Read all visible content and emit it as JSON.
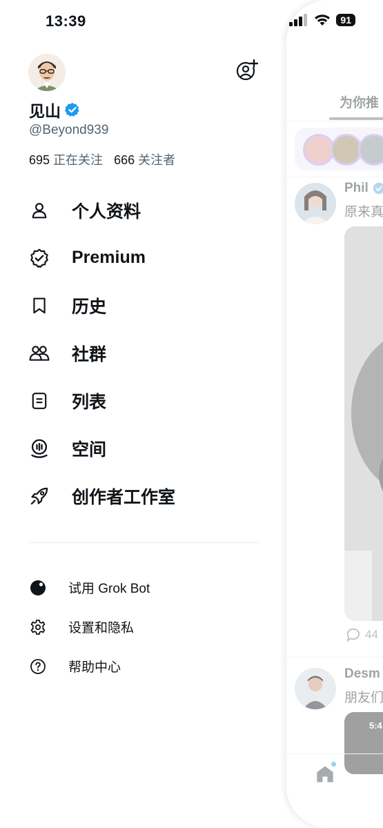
{
  "status_bar": {
    "time": "13:39",
    "battery": "91"
  },
  "profile": {
    "display_name": "见山",
    "handle": "@Beyond939",
    "following_count": "695",
    "following_label": "正在关注",
    "followers_count": "666",
    "followers_label": "关注者"
  },
  "menu": [
    {
      "label": "个人资料",
      "icon": "person-icon"
    },
    {
      "label": "Premium",
      "icon": "premium-badge-icon"
    },
    {
      "label": "历史",
      "icon": "bookmark-icon"
    },
    {
      "label": "社群",
      "icon": "communities-icon"
    },
    {
      "label": "列表",
      "icon": "list-icon"
    },
    {
      "label": "空间",
      "icon": "spaces-icon"
    },
    {
      "label": "创作者工作室",
      "icon": "rocket-icon"
    }
  ],
  "sub_menu": [
    {
      "label": "试用 Grok Bot",
      "icon": "grok-icon"
    },
    {
      "label": "设置和隐私",
      "icon": "gear-icon"
    },
    {
      "label": "帮助中心",
      "icon": "help-icon"
    }
  ],
  "feed": {
    "tab_label": "为你推",
    "post1_name": "Phil",
    "post1_text": "原来真",
    "post1_replies": "44",
    "post2_name": "Desm",
    "post2_text": "朋友们",
    "post2_media_time": "5:4"
  },
  "colors": {
    "verified": "#1d9bf0",
    "secondary_text": "#536471",
    "story_ring": "#c5b6ee"
  }
}
